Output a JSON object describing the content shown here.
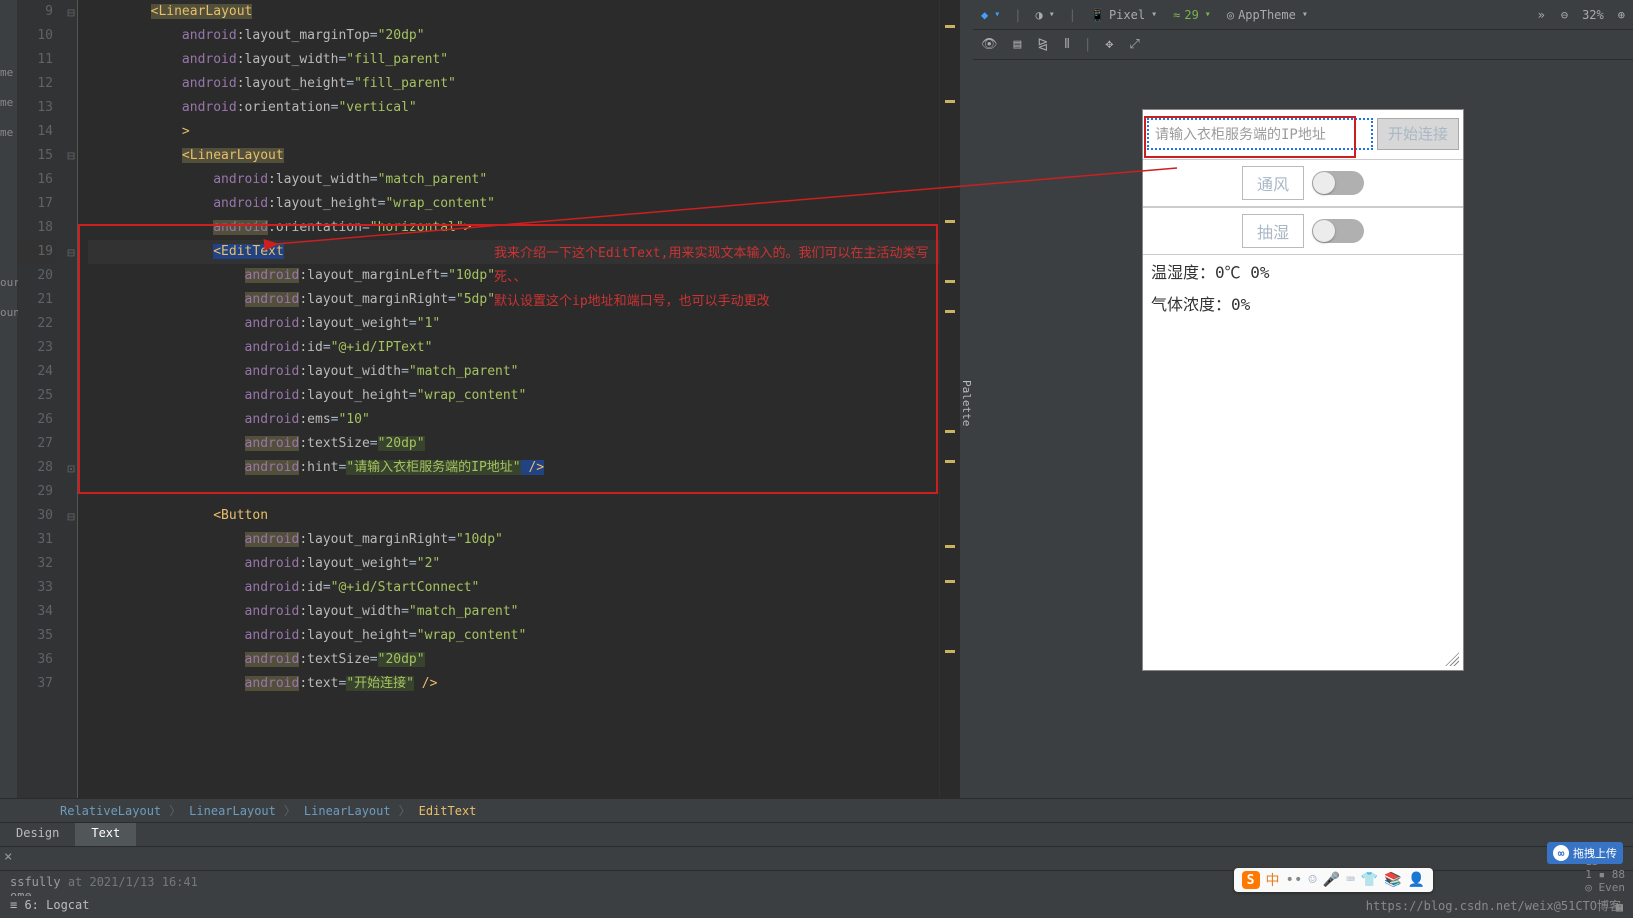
{
  "lines": [
    9,
    10,
    11,
    12,
    13,
    14,
    15,
    16,
    17,
    18,
    19,
    20,
    21,
    22,
    23,
    24,
    25,
    26,
    27,
    28,
    29,
    30,
    31,
    32,
    33,
    34,
    35,
    36,
    37
  ],
  "code": {
    "l9": "<LinearLayout",
    "l10_attr": "android:layout_marginTop",
    "l10_val": "\"20dp\"",
    "l11_attr": "android:layout_width",
    "l11_val": "\"fill_parent\"",
    "l12_attr": "android:layout_height",
    "l12_val": "\"fill_parent\"",
    "l13_attr": "android:orientation",
    "l13_val": "\"vertical\"",
    "l14": ">",
    "l15": "<LinearLayout",
    "l16_attr": "android:layout_width",
    "l16_val": "\"match_parent\"",
    "l17_attr": "android:layout_height",
    "l17_val": "\"wrap_content\"",
    "l18_attr": "android:orientation",
    "l18_val": "\"horizontal\"",
    "l18_end": ">",
    "l19": "<EditText",
    "l20_attr": "android:layout_marginLeft",
    "l20_val": "\"10dp\"",
    "l21_attr": "android:layout_marginRight",
    "l21_val": "\"5dp\"",
    "l22_attr": "android:layout_weight",
    "l22_val": "\"1\"",
    "l23_attr": "android:id",
    "l23_val": "\"@+id/IPText\"",
    "l24_attr": "android:layout_width",
    "l24_val": "\"match_parent\"",
    "l25_attr": "android:layout_height",
    "l25_val": "\"wrap_content\"",
    "l26_attr": "android:ems",
    "l26_val": "\"10\"",
    "l27_attr": "android:textSize",
    "l27_val": "\"20dp\"",
    "l28_attr": "android:hint",
    "l28_val": "\"请输入衣柜服务端的IP地址\"",
    "l28_end": " />",
    "l30": "<Button",
    "l31_attr": "android:layout_marginRight",
    "l31_val": "\"10dp\"",
    "l32_attr": "android:layout_weight",
    "l32_val": "\"2\"",
    "l33_attr": "android:id",
    "l33_val": "\"@+id/StartConnect\"",
    "l34_attr": "android:layout_width",
    "l34_val": "\"match_parent\"",
    "l35_attr": "android:layout_height",
    "l35_val": "\"wrap_content\"",
    "l36_attr": "android:textSize",
    "l36_val": "\"20dp\"",
    "l37_attr": "android:text",
    "l37_val": "\"开始连接\"",
    "l37_end": " />"
  },
  "annotation": {
    "line1": "我来介绍一下这个EditText,用来实现文本输入的。我们可以在主活动类写死、、",
    "line2": "默认设置这个ip地址和端口号，也可以手动更改"
  },
  "breadcrumb": [
    "RelativeLayout",
    "LinearLayout",
    "LinearLayout",
    "EditText"
  ],
  "tabs": {
    "design": "Design",
    "text": "Text"
  },
  "toolbar": {
    "palette": "Palette",
    "device": "Pixel",
    "api": "29",
    "theme": "AppTheme",
    "zoom": "32%"
  },
  "preview": {
    "input_hint": "请输入衣柜服务端的IP地址",
    "connect": "开始连接",
    "vent": "通风",
    "humid": "抽湿",
    "temp": "温湿度：0℃ 0%",
    "gas": "气体浓度：0%"
  },
  "status": {
    "success": "ssfully",
    "time": "at 2021/1/13 16:41",
    "text2": "ome",
    "logcat": "≡  6: Logcat",
    "url": "https://blog.csdn.net/weix",
    "cto": "@51CTO博客",
    "float": "拖拽上传"
  },
  "truncated": [
    "me",
    "me",
    "me",
    "our",
    "oun"
  ]
}
